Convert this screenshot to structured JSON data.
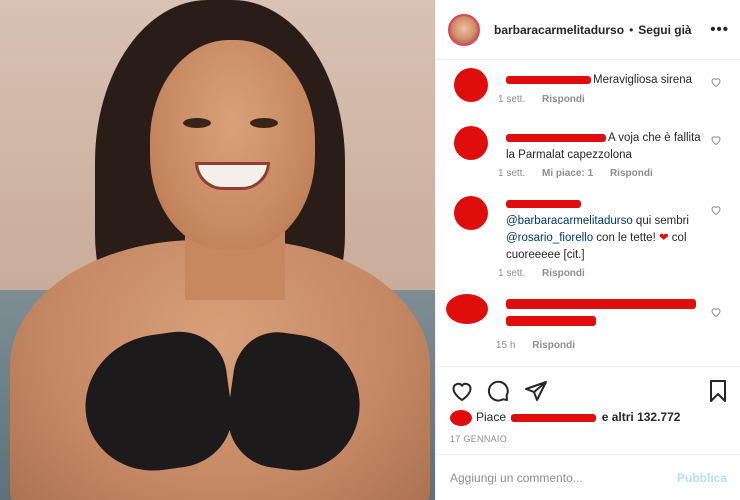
{
  "header": {
    "username": "barbaracarmelitadurso",
    "separator": "•",
    "follow_label": "Segui già",
    "more_label": "•••"
  },
  "comments": [
    {
      "text": "Meravigliosa sirena",
      "time": "1 sett.",
      "likes": "",
      "reply_label": "Rispondi"
    },
    {
      "text": "A voja che è fallita la Parmalat capezzolona",
      "time": "1 sett.",
      "likes": "Mi piace: 1",
      "reply_label": "Rispondi"
    },
    {
      "mention1": "@barbaracarmelitadurso",
      "text1": " qui sembri ",
      "mention2": "@rosario_fiorello",
      "text2": " con le tette! ",
      "emoji": "❤",
      "text3": " col cuoreeeee [cit.]",
      "time": "1 sett.",
      "reply_label": "Rispondi"
    },
    {
      "text": "",
      "time": "15 h",
      "reply_label": "Rispondi"
    }
  ],
  "likes": {
    "prefix": "Piace",
    "suffix": "e altri 132.772"
  },
  "date": "17 GENNAIO",
  "add_comment": {
    "placeholder": "Aggiungi un commento...",
    "publish_label": "Pubblica"
  },
  "colors": {
    "accent_blue": "#0095f6",
    "publish_disabled": "#b2dffc",
    "redaction": "#e00d0d"
  }
}
